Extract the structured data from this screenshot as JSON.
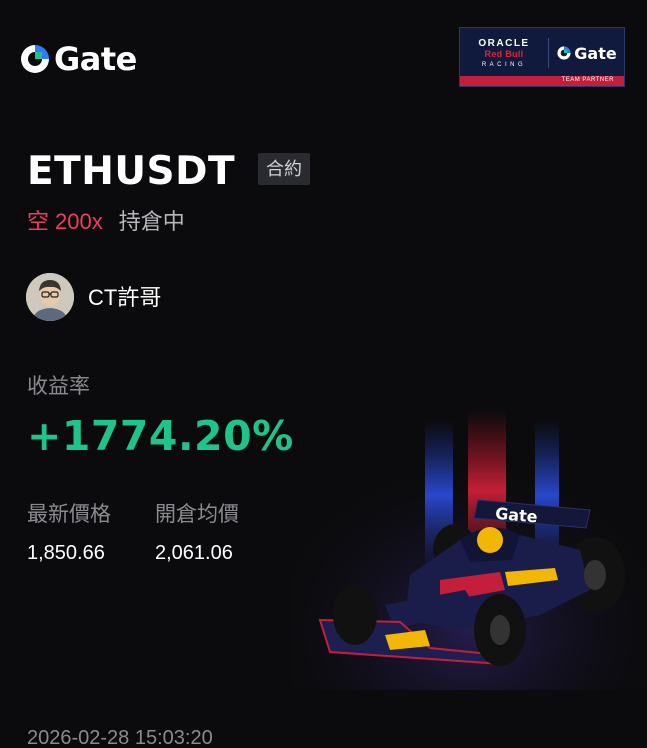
{
  "brand": {
    "name": "Gate",
    "accent": "#2f7cf6",
    "logo_icon": "gate-logo-icon"
  },
  "partner": {
    "oracle": "ORACLE",
    "redbull": "Red Bull",
    "racing": "RACING",
    "gate": "Gate",
    "strip": "TEAM PARTNER"
  },
  "trade": {
    "symbol": "ETHUSDT",
    "contract_tag": "合約",
    "side": "空",
    "leverage": "200x",
    "status": "持倉中"
  },
  "user": {
    "name": "CT許哥",
    "avatar_icon": "avatar-image"
  },
  "roi": {
    "label": "收益率",
    "value": "+1774.20%",
    "color": "#1fc48b"
  },
  "stats": {
    "latest_label": "最新價格",
    "latest_value": "1,850.66",
    "entry_label": "開倉均價",
    "entry_value": "2,061.06"
  },
  "car_livery": "Gate",
  "timestamp": "2026-02-28 15:03:20",
  "colors": {
    "background": "#0b0b0d",
    "short": "#ee3d5e",
    "profit": "#1fc48b",
    "muted": "#8a8a91"
  }
}
